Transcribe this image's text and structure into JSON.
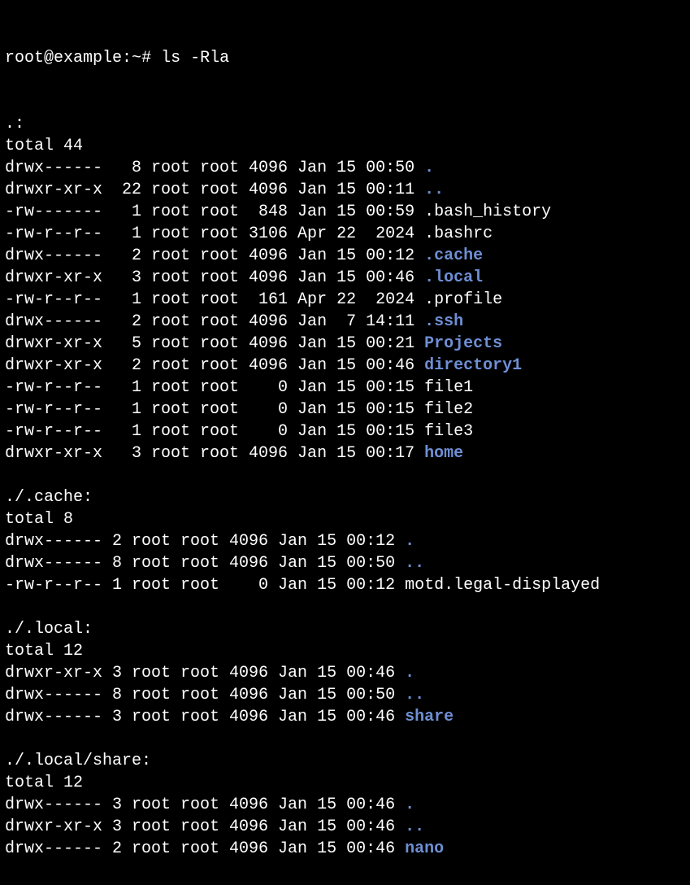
{
  "prompt": {
    "user_host": "root@example",
    "cwd_symbol": "~",
    "hash": "#",
    "command": "ls -Rla"
  },
  "sections": [
    {
      "header": ".:",
      "total": "total 44",
      "rows": [
        {
          "perm": "drwx------",
          "lnk": " 8",
          "own": "root",
          "grp": "root",
          "size": "4096",
          "date": "Jan 15 00:50",
          "name": ".",
          "dir": true
        },
        {
          "perm": "drwxr-xr-x",
          "lnk": "22",
          "own": "root",
          "grp": "root",
          "size": "4096",
          "date": "Jan 15 00:11",
          "name": "..",
          "dir": true
        },
        {
          "perm": "-rw-------",
          "lnk": " 1",
          "own": "root",
          "grp": "root",
          "size": " 848",
          "date": "Jan 15 00:59",
          "name": ".bash_history",
          "dir": false
        },
        {
          "perm": "-rw-r--r--",
          "lnk": " 1",
          "own": "root",
          "grp": "root",
          "size": "3106",
          "date": "Apr 22  2024",
          "name": ".bashrc",
          "dir": false
        },
        {
          "perm": "drwx------",
          "lnk": " 2",
          "own": "root",
          "grp": "root",
          "size": "4096",
          "date": "Jan 15 00:12",
          "name": ".cache",
          "dir": true
        },
        {
          "perm": "drwxr-xr-x",
          "lnk": " 3",
          "own": "root",
          "grp": "root",
          "size": "4096",
          "date": "Jan 15 00:46",
          "name": ".local",
          "dir": true
        },
        {
          "perm": "-rw-r--r--",
          "lnk": " 1",
          "own": "root",
          "grp": "root",
          "size": " 161",
          "date": "Apr 22  2024",
          "name": ".profile",
          "dir": false
        },
        {
          "perm": "drwx------",
          "lnk": " 2",
          "own": "root",
          "grp": "root",
          "size": "4096",
          "date": "Jan  7 14:11",
          "name": ".ssh",
          "dir": true
        },
        {
          "perm": "drwxr-xr-x",
          "lnk": " 5",
          "own": "root",
          "grp": "root",
          "size": "4096",
          "date": "Jan 15 00:21",
          "name": "Projects",
          "dir": true
        },
        {
          "perm": "drwxr-xr-x",
          "lnk": " 2",
          "own": "root",
          "grp": "root",
          "size": "4096",
          "date": "Jan 15 00:46",
          "name": "directory1",
          "dir": true
        },
        {
          "perm": "-rw-r--r--",
          "lnk": " 1",
          "own": "root",
          "grp": "root",
          "size": "   0",
          "date": "Jan 15 00:15",
          "name": "file1",
          "dir": false
        },
        {
          "perm": "-rw-r--r--",
          "lnk": " 1",
          "own": "root",
          "grp": "root",
          "size": "   0",
          "date": "Jan 15 00:15",
          "name": "file2",
          "dir": false
        },
        {
          "perm": "-rw-r--r--",
          "lnk": " 1",
          "own": "root",
          "grp": "root",
          "size": "   0",
          "date": "Jan 15 00:15",
          "name": "file3",
          "dir": false
        },
        {
          "perm": "drwxr-xr-x",
          "lnk": " 3",
          "own": "root",
          "grp": "root",
          "size": "4096",
          "date": "Jan 15 00:17",
          "name": "home",
          "dir": true
        }
      ],
      "col_widths": {
        "lnk": 3,
        "size": 4
      }
    },
    {
      "header": "./.cache:",
      "total": "total 8",
      "rows": [
        {
          "perm": "drwx------",
          "lnk": "2",
          "own": "root",
          "grp": "root",
          "size": "4096",
          "date": "Jan 15 00:12",
          "name": ".",
          "dir": true
        },
        {
          "perm": "drwx------",
          "lnk": "8",
          "own": "root",
          "grp": "root",
          "size": "4096",
          "date": "Jan 15 00:50",
          "name": "..",
          "dir": true
        },
        {
          "perm": "-rw-r--r--",
          "lnk": "1",
          "own": "root",
          "grp": "root",
          "size": "   0",
          "date": "Jan 15 00:12",
          "name": "motd.legal-displayed",
          "dir": false
        }
      ],
      "col_widths": {
        "lnk": 1,
        "size": 4
      }
    },
    {
      "header": "./.local:",
      "total": "total 12",
      "rows": [
        {
          "perm": "drwxr-xr-x",
          "lnk": "3",
          "own": "root",
          "grp": "root",
          "size": "4096",
          "date": "Jan 15 00:46",
          "name": ".",
          "dir": true
        },
        {
          "perm": "drwx------",
          "lnk": "8",
          "own": "root",
          "grp": "root",
          "size": "4096",
          "date": "Jan 15 00:50",
          "name": "..",
          "dir": true
        },
        {
          "perm": "drwx------",
          "lnk": "3",
          "own": "root",
          "grp": "root",
          "size": "4096",
          "date": "Jan 15 00:46",
          "name": "share",
          "dir": true
        }
      ],
      "col_widths": {
        "lnk": 1,
        "size": 4
      }
    },
    {
      "header": "./.local/share:",
      "total": "total 12",
      "rows": [
        {
          "perm": "drwx------",
          "lnk": "3",
          "own": "root",
          "grp": "root",
          "size": "4096",
          "date": "Jan 15 00:46",
          "name": ".",
          "dir": true
        },
        {
          "perm": "drwxr-xr-x",
          "lnk": "3",
          "own": "root",
          "grp": "root",
          "size": "4096",
          "date": "Jan 15 00:46",
          "name": "..",
          "dir": true
        },
        {
          "perm": "drwx------",
          "lnk": "2",
          "own": "root",
          "grp": "root",
          "size": "4096",
          "date": "Jan 15 00:46",
          "name": "nano",
          "dir": true
        }
      ],
      "col_widths": {
        "lnk": 1,
        "size": 4
      }
    }
  ]
}
